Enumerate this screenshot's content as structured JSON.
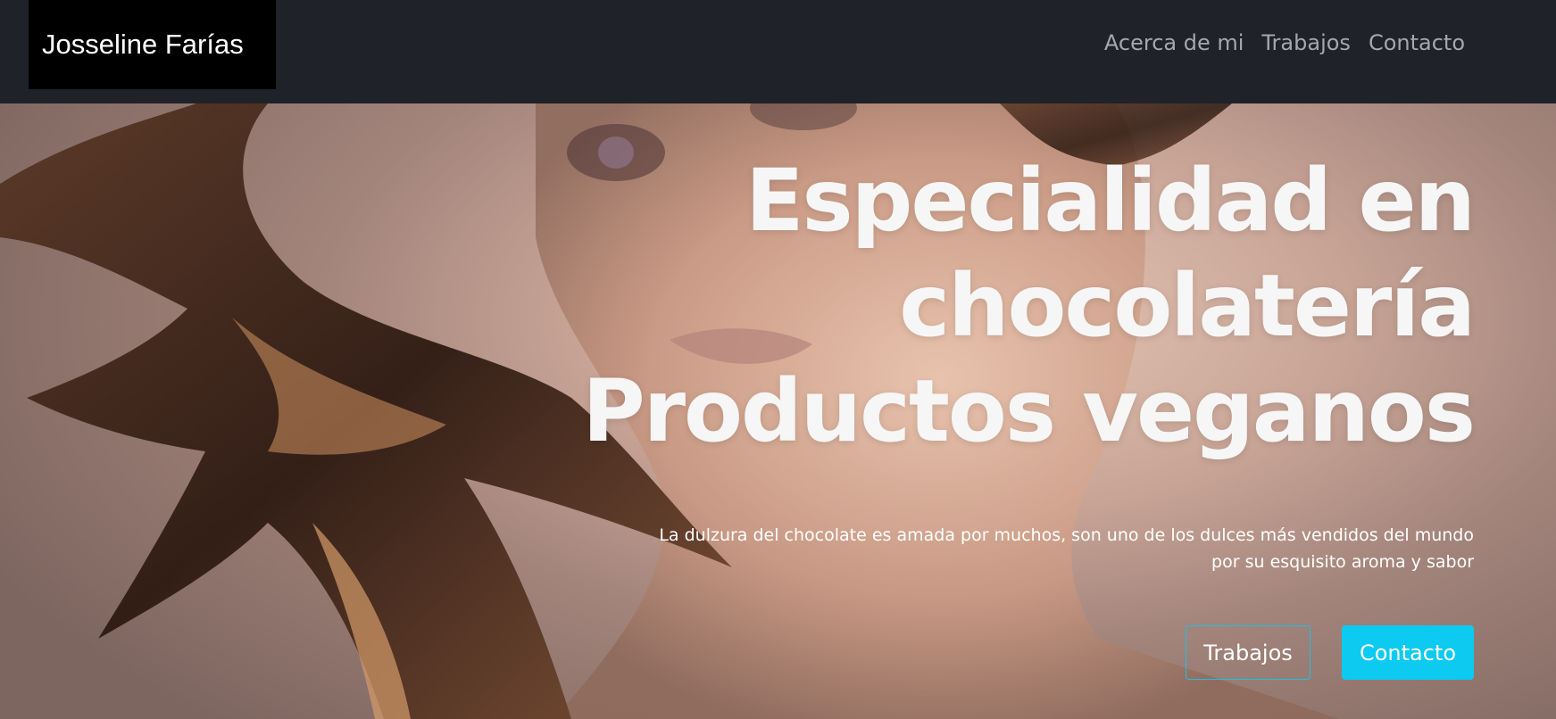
{
  "navbar": {
    "brand": "Josseline Farías",
    "links": [
      {
        "label": "Acerca de mi"
      },
      {
        "label": "Trabajos"
      },
      {
        "label": "Contacto"
      }
    ]
  },
  "hero": {
    "title_lines": [
      "Especialidad en",
      "chocolatería",
      "Productos veganos"
    ],
    "subtitle": "La dulzura del chocolate es amada por muchos, son uno de los dulces más vendidos del mundo por su esquisito aroma y sabor",
    "buttons": {
      "works_label": "Trabajos",
      "contact_label": "Contacto"
    }
  },
  "colors": {
    "navbar_bg": "#1f2228",
    "brand_bg": "#000000",
    "nav_link": "#a4a8ae",
    "accent": "#0ccaf0"
  }
}
